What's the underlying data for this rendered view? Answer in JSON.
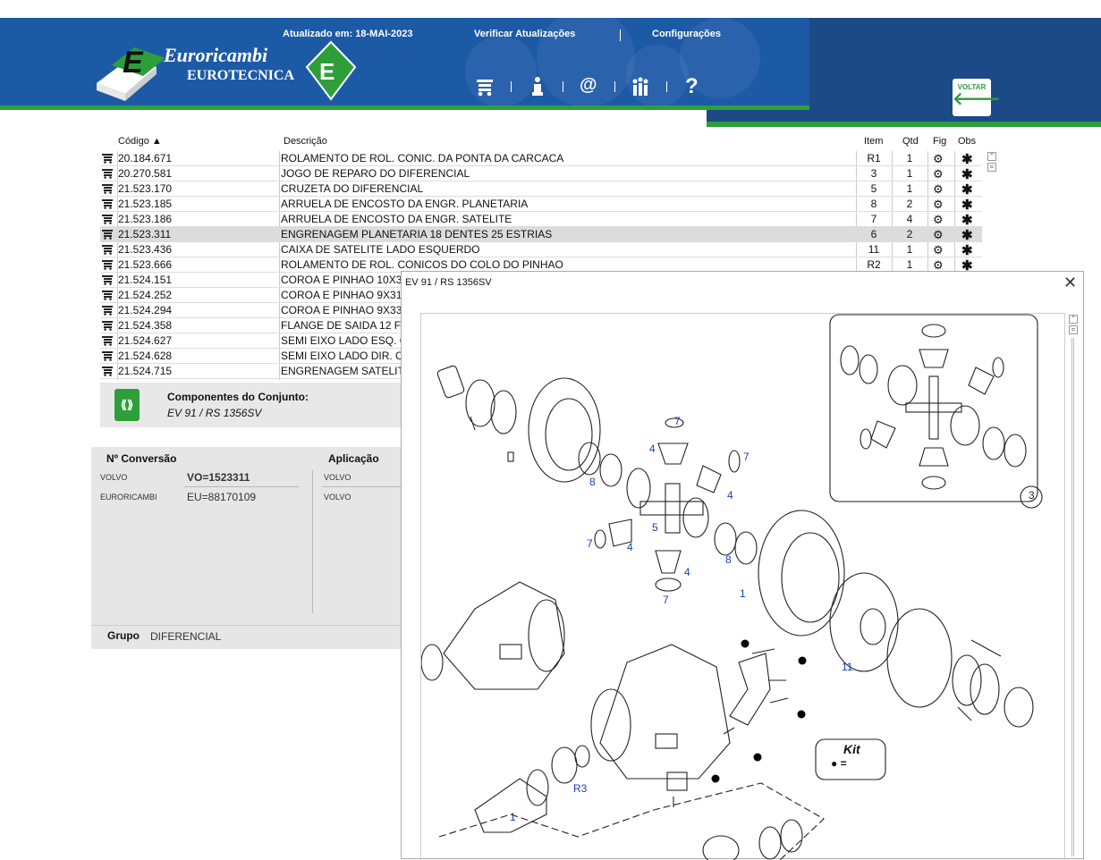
{
  "header": {
    "updated": "Atualizado em: 18-MAI-2023",
    "check_updates": "Verificar Atualizações",
    "settings": "Configurações",
    "logo_line1": "Euroricambi",
    "logo_line2": "EUROTECNICA",
    "back_label": "VOLTAR",
    "icons": [
      "cart-icon",
      "info-icon",
      "at-icon",
      "people-icon",
      "help-icon"
    ]
  },
  "table": {
    "headers": {
      "codigo": "Código",
      "descricao": "Descrição",
      "item": "Item",
      "qtd": "Qtd",
      "fig": "Fig",
      "obs": "Obs"
    },
    "rows": [
      {
        "codigo": "20.184.671",
        "descricao": "ROLAMENTO DE ROL. CONIC. DA PONTA DA CARCACA",
        "item": "R1",
        "qtd": "1"
      },
      {
        "codigo": "20.270.581",
        "descricao": "JOGO DE REPARO DO DIFERENCIAL",
        "item": "3",
        "qtd": "1"
      },
      {
        "codigo": "21.523.170",
        "descricao": "CRUZETA DO DIFERENCIAL",
        "item": "5",
        "qtd": "1"
      },
      {
        "codigo": "21.523.185",
        "descricao": "ARRUELA DE ENCOSTO DA ENGR. PLANETARIA",
        "item": "8",
        "qtd": "2"
      },
      {
        "codigo": "21.523.186",
        "descricao": "ARRUELA DE ENCOSTO DA ENGR. SATELITE",
        "item": "7",
        "qtd": "4"
      },
      {
        "codigo": "21.523.311",
        "descricao": "ENGRENAGEM PLANETARIA 18 DENTES 25 ESTRIAS",
        "item": "6",
        "qtd": "2",
        "selected": true
      },
      {
        "codigo": "21.523.436",
        "descricao": "CAIXA DE SATELITE LADO ESQUERDO",
        "item": "11",
        "qtd": "1"
      },
      {
        "codigo": "21.523.666",
        "descricao": "ROLAMENTO DE ROL. CONICOS DO COLO DO PINHAO",
        "item": "R2",
        "qtd": "1"
      },
      {
        "codigo": "21.524.151",
        "descricao": "COROA E PINHAO 10X3",
        "item": "",
        "qtd": ""
      },
      {
        "codigo": "21.524.252",
        "descricao": "COROA E PINHAO 9X31",
        "item": "",
        "qtd": ""
      },
      {
        "codigo": "21.524.294",
        "descricao": "COROA E PINHAO 9X33",
        "item": "",
        "qtd": ""
      },
      {
        "codigo": "21.524.358",
        "descricao": "FLANGE DE SAIDA 12 FU",
        "item": "",
        "qtd": ""
      },
      {
        "codigo": "21.524.627",
        "descricao": "SEMI EIXO LADO ESQ. C",
        "item": "",
        "qtd": ""
      },
      {
        "codigo": "21.524.628",
        "descricao": "SEMI EIXO LADO DIR. C",
        "item": "",
        "qtd": ""
      },
      {
        "codigo": "21.524.715",
        "descricao": "ENGRENAGEM SATELIT",
        "item": "",
        "qtd": ""
      }
    ]
  },
  "components": {
    "title": "Componentes do Conjunto:",
    "subtitle": "EV 91 / RS 1356SV"
  },
  "conversion": {
    "header": "Nº Conversão",
    "app_header": "Aplicação",
    "rows": [
      {
        "brand": "VOLVO",
        "code": "VO=1523311",
        "app": "VOLVO"
      },
      {
        "brand": "EURORICAMBI",
        "code": "EU=88170109",
        "app": "VOLVO"
      }
    ],
    "group_label": "Grupo",
    "group_value": "DIFERENCIAL"
  },
  "modal": {
    "title": "EV 91 / RS 1356SV",
    "labels": [
      "7",
      "4",
      "7",
      "8",
      "4",
      "5",
      "7",
      "4",
      "4",
      "8",
      "7",
      "1",
      "11",
      "R3",
      "1",
      "3"
    ],
    "kit_label": "Kit",
    "kit_eq": "● ="
  }
}
